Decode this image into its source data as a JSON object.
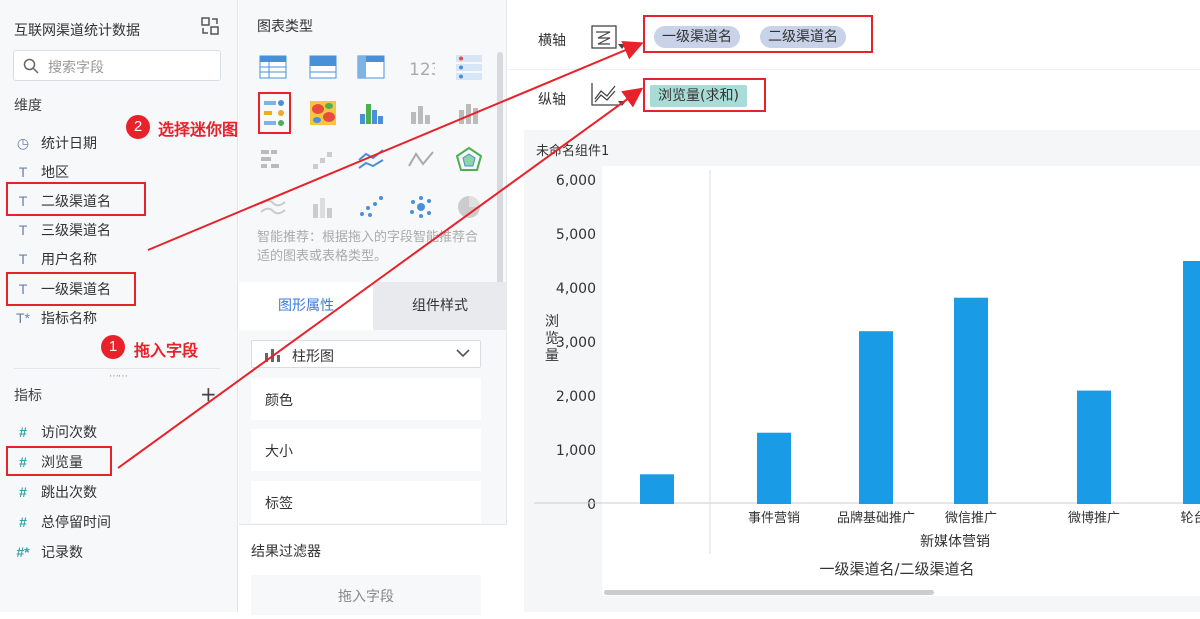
{
  "left": {
    "dataset_title": "互联网渠道统计数据",
    "search_placeholder": "搜索字段",
    "dimensions_label": "维度",
    "dimensions": [
      {
        "icon": "clock-icon",
        "glyph": "◷",
        "label": "统计日期"
      },
      {
        "icon": "text-type-icon",
        "glyph": "T",
        "label": "地区"
      },
      {
        "icon": "text-type-icon",
        "glyph": "T",
        "label": "二级渠道名"
      },
      {
        "icon": "text-type-icon",
        "glyph": "T",
        "label": "三级渠道名"
      },
      {
        "icon": "text-type-icon",
        "glyph": "T",
        "label": "用户名称"
      },
      {
        "icon": "text-type-icon",
        "glyph": "T",
        "label": "一级渠道名"
      },
      {
        "icon": "text-type-icon",
        "glyph": "T*",
        "label": "指标名称"
      }
    ],
    "metrics_label": "指标",
    "metrics": [
      {
        "glyph": "#",
        "label": "访问次数"
      },
      {
        "glyph": "#",
        "label": "浏览量"
      },
      {
        "glyph": "#",
        "label": "跳出次数"
      },
      {
        "glyph": "#",
        "label": "总停留时间"
      },
      {
        "glyph": "#*",
        "label": "记录数"
      }
    ]
  },
  "middle": {
    "chart_types_title": "图表类型",
    "hint": "智能推荐：根据拖入的字段智能推荐合适的图表或表格类型。",
    "tabs": [
      "图形属性",
      "组件样式"
    ],
    "chart_select": "柱形图",
    "props": [
      "颜色",
      "大小",
      "标签"
    ],
    "filter_title": "结果过滤器",
    "drop_text": "拖入字段"
  },
  "right": {
    "x_axis_label": "横轴",
    "y_axis_label": "纵轴",
    "x_pills": [
      "一级渠道名",
      "二级渠道名"
    ],
    "y_pills": [
      "浏览量(求和)"
    ],
    "component_title": "未命名组件1"
  },
  "annotations": {
    "step1_num": "1",
    "step1_text": "拖入字段",
    "step2_num": "2",
    "step2_text": "选择迷你图"
  },
  "colors": {
    "annotation_red": "#e8222a",
    "bar_blue": "#1a9be6",
    "accent": "#3c7bd6"
  },
  "chart_data": {
    "type": "bar",
    "ylabel": "浏览量",
    "xlabel": "一级渠道名/二级渠道名",
    "ylim": [
      0,
      6000
    ],
    "yticks": [
      "6,000",
      "5,000",
      "4,000",
      "3,000",
      "2,000",
      "1,000",
      "0"
    ],
    "groups": [
      {
        "name": "",
        "categories": [
          ""
        ]
      },
      {
        "name": "新媒体营销",
        "categories": [
          "事件营销",
          "品牌基础推广",
          "微信推广",
          "微博推广",
          "轮台、"
        ]
      }
    ],
    "values": [
      550,
      1320,
      3200,
      3820,
      2100,
      4500
    ]
  }
}
